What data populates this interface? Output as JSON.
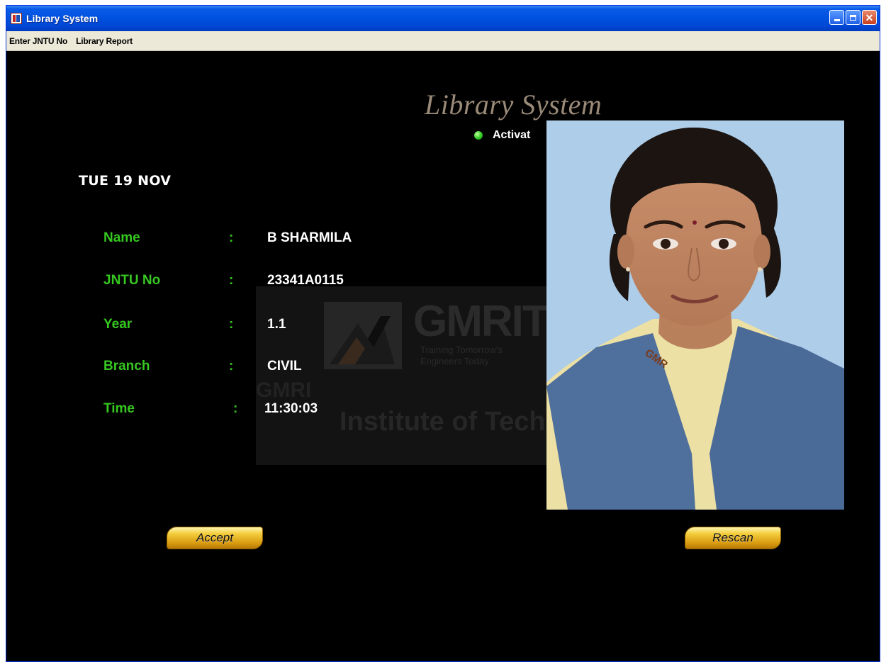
{
  "window": {
    "title": "Library System"
  },
  "menu": [
    {
      "label": "Enter JNTU No"
    },
    {
      "label": "Library Report"
    }
  ],
  "heading": "Library System",
  "status": {
    "text": "Activat"
  },
  "date": "TUE 19 NOV",
  "fields": [
    {
      "label": "Name",
      "value": "B SHARMILA"
    },
    {
      "label": "JNTU No",
      "value": "23341A0115"
    },
    {
      "label": "Year",
      "value": "1.1"
    },
    {
      "label": "Branch",
      "value": "CIVIL"
    },
    {
      "label": "Time",
      "value": "11:30:03"
    }
  ],
  "colon": ":",
  "watermark": {
    "brand": "GMRIT",
    "tagline_1": "Training Tomorrow's",
    "tagline_2": "Engineers Today",
    "fragment": "GMRI",
    "institute": "Institute of Tech"
  },
  "photo": {
    "badge": "GMR"
  },
  "buttons": {
    "accept": "Accept",
    "rescan": "Rescan"
  },
  "colors": {
    "label_green": "#36c820",
    "status_green": "#27c21a",
    "button_gold": "#f3cd3c"
  }
}
